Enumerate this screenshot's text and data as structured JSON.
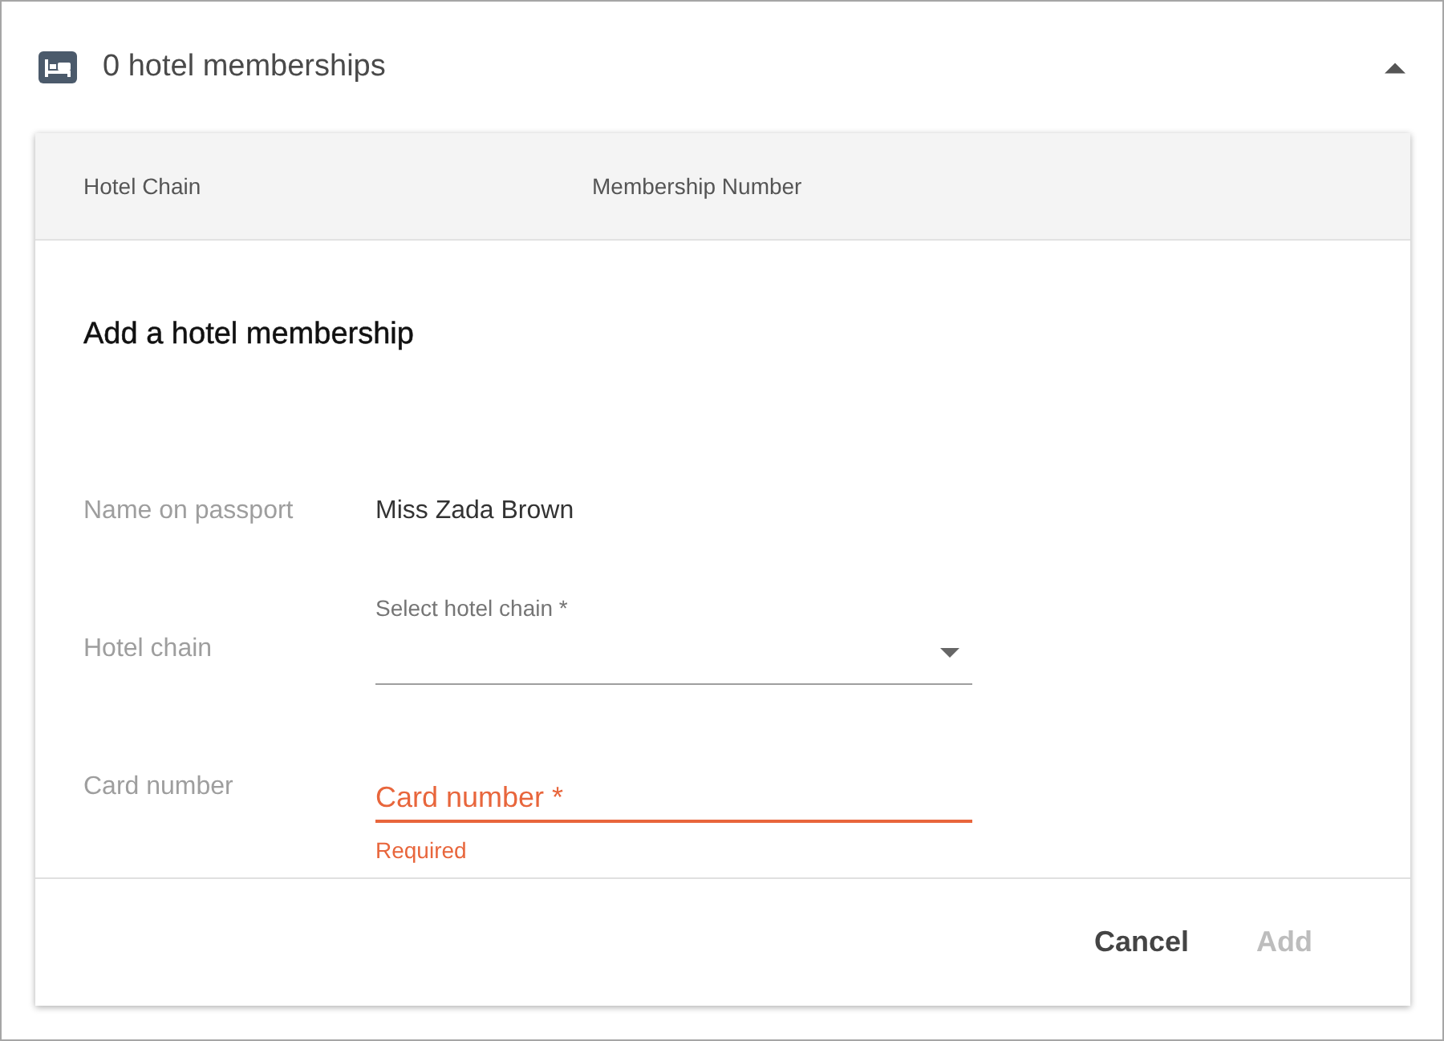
{
  "header": {
    "title": "0 hotel memberships",
    "expanded": true
  },
  "table": {
    "columns": [
      "Hotel Chain",
      "Membership Number"
    ]
  },
  "form": {
    "title": "Add a hotel membership",
    "fields": [
      {
        "kind": "text",
        "label": "Name on passport",
        "value": "Miss Zada Brown"
      },
      {
        "kind": "select",
        "label": "Hotel chain",
        "field_label": "Select hotel chain *"
      },
      {
        "kind": "input",
        "label": "Card number",
        "placeholder": "Card number *",
        "error": "Required"
      }
    ]
  },
  "buttons": [
    {
      "label": "Cancel",
      "disabled": false
    },
    {
      "label": "Add",
      "disabled": true
    }
  ]
}
